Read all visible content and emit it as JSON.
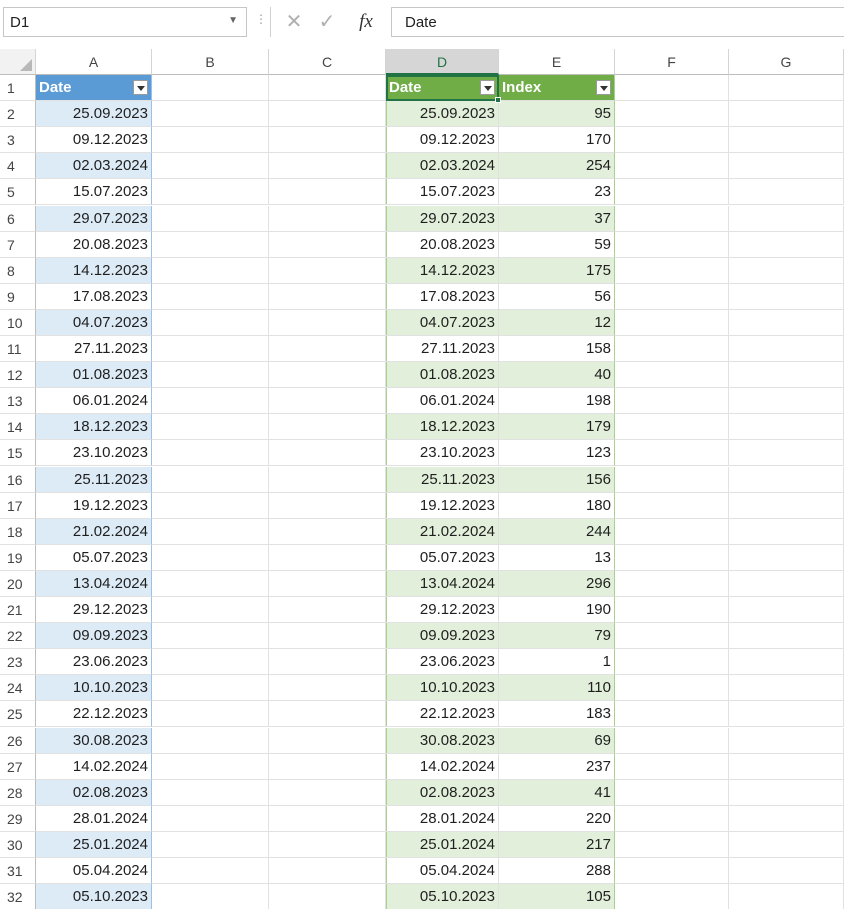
{
  "name_box": {
    "value": "D1"
  },
  "formula_bar": {
    "value": "Date",
    "fx_label": "fx"
  },
  "icons": {
    "cancel": "close-icon",
    "enter": "check-icon",
    "function": "fx-icon",
    "dropdown": "chevron-down-icon",
    "filter": "filter-dropdown-icon"
  },
  "columns": [
    "A",
    "B",
    "C",
    "D",
    "E",
    "F",
    "G"
  ],
  "selected_column": "D",
  "table1": {
    "header": "Date",
    "style_color": "#5b9bd5",
    "dates": [
      "25.09.2023",
      "09.12.2023",
      "02.03.2024",
      "15.07.2023",
      "29.07.2023",
      "20.08.2023",
      "14.12.2023",
      "17.08.2023",
      "04.07.2023",
      "27.11.2023",
      "01.08.2023",
      "06.01.2024",
      "18.12.2023",
      "23.10.2023",
      "25.11.2023",
      "19.12.2023",
      "21.02.2024",
      "05.07.2023",
      "13.04.2024",
      "29.12.2023",
      "09.09.2023",
      "23.06.2023",
      "10.10.2023",
      "22.12.2023",
      "30.08.2023",
      "14.02.2024",
      "02.08.2023",
      "28.01.2024",
      "25.01.2024",
      "05.04.2024",
      "05.10.2023"
    ]
  },
  "table2": {
    "headers": [
      "Date",
      "Index"
    ],
    "style_color": "#70ad47",
    "rows": [
      [
        "25.09.2023",
        "95"
      ],
      [
        "09.12.2023",
        "170"
      ],
      [
        "02.03.2024",
        "254"
      ],
      [
        "15.07.2023",
        "23"
      ],
      [
        "29.07.2023",
        "37"
      ],
      [
        "20.08.2023",
        "59"
      ],
      [
        "14.12.2023",
        "175"
      ],
      [
        "17.08.2023",
        "56"
      ],
      [
        "04.07.2023",
        "12"
      ],
      [
        "27.11.2023",
        "158"
      ],
      [
        "01.08.2023",
        "40"
      ],
      [
        "06.01.2024",
        "198"
      ],
      [
        "18.12.2023",
        "179"
      ],
      [
        "23.10.2023",
        "123"
      ],
      [
        "25.11.2023",
        "156"
      ],
      [
        "19.12.2023",
        "180"
      ],
      [
        "21.02.2024",
        "244"
      ],
      [
        "05.07.2023",
        "13"
      ],
      [
        "13.04.2024",
        "296"
      ],
      [
        "29.12.2023",
        "190"
      ],
      [
        "09.09.2023",
        "79"
      ],
      [
        "23.06.2023",
        "1"
      ],
      [
        "10.10.2023",
        "110"
      ],
      [
        "22.12.2023",
        "183"
      ],
      [
        "30.08.2023",
        "69"
      ],
      [
        "14.02.2024",
        "237"
      ],
      [
        "02.08.2023",
        "41"
      ],
      [
        "28.01.2024",
        "220"
      ],
      [
        "25.01.2024",
        "217"
      ],
      [
        "05.04.2024",
        "288"
      ],
      [
        "05.10.2023",
        "105"
      ]
    ]
  }
}
